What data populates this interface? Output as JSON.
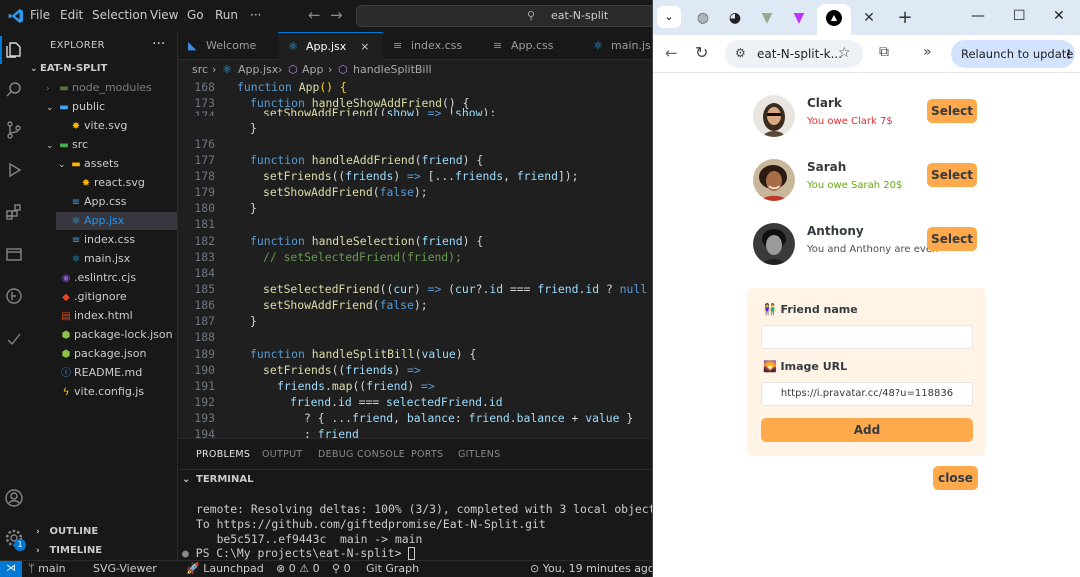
{
  "vscode": {
    "menu": [
      "File",
      "Edit",
      "Selection",
      "View",
      "Go",
      "Run",
      "···"
    ],
    "search_text": "eat-N-split",
    "explorer": {
      "title": "EXPLORER",
      "project": "EAT-N-SPLIT",
      "items": [
        {
          "label": "node_modules",
          "icon": "folder-icon"
        },
        {
          "label": "public",
          "icon": "folder-icon"
        },
        {
          "label": "vite.svg",
          "icon": "svg-file-icon"
        },
        {
          "label": "src",
          "icon": "folder-icon"
        },
        {
          "label": "assets",
          "icon": "folder-icon"
        },
        {
          "label": "react.svg",
          "icon": "svg-file-icon"
        },
        {
          "label": "App.css",
          "icon": "css-file-icon"
        },
        {
          "label": "App.jsx",
          "icon": "react-file-icon"
        },
        {
          "label": "index.css",
          "icon": "css-file-icon"
        },
        {
          "label": "main.jsx",
          "icon": "react-file-icon"
        },
        {
          "label": ".eslintrc.cjs",
          "icon": "eslint-file-icon"
        },
        {
          "label": ".gitignore",
          "icon": "git-file-icon"
        },
        {
          "label": "index.html",
          "icon": "html-file-icon"
        },
        {
          "label": "package-lock.json",
          "icon": "json-file-icon"
        },
        {
          "label": "package.json",
          "icon": "json-file-icon"
        },
        {
          "label": "README.md",
          "icon": "info-file-icon"
        },
        {
          "label": "vite.config.js",
          "icon": "js-file-icon"
        }
      ],
      "outline": "OUTLINE",
      "timeline": "TIMELINE"
    },
    "tabs": [
      "Welcome",
      "App.jsx",
      "index.css",
      "App.css",
      "main.js"
    ],
    "breadcrumb": [
      "src",
      "App.jsx",
      "App",
      "handleSplitBill"
    ],
    "line_numbers": [
      "168",
      "173",
      "174",
      "176",
      "177",
      "178",
      "179",
      "180",
      "181",
      "182",
      "183",
      "184",
      "185",
      "186",
      "187",
      "188",
      "189",
      "190",
      "191",
      "192",
      "193",
      "194"
    ],
    "panel_tabs": [
      "PROBLEMS",
      "OUTPUT",
      "DEBUG CONSOLE",
      "PORTS",
      "GITLENS"
    ],
    "terminal_title": "TERMINAL",
    "terminal_lines": [
      "remote: Resolving deltas: 100% (3/3), completed with 3 local objects.",
      "To https://github.com/giftedpromise/Eat-N-Split.git",
      "   be5c517..ef9443c  main -> main",
      "PS C:\\My projects\\eat-N-split> "
    ],
    "status": {
      "branch": "main",
      "svg_viewer": "SVG-Viewer",
      "launchpad": "Launchpad",
      "errors": "0",
      "warnings": "0",
      "ports": "0",
      "git_graph": "Git Graph",
      "blame": "You, 19 minutes ago",
      "badge": "1"
    }
  },
  "chrome": {
    "url": "eat-N-split-k...",
    "relaunch": "Relaunch to update",
    "friends": [
      {
        "name": "Clark",
        "balance": "You owe Clark 7$",
        "status": "owe"
      },
      {
        "name": "Sarah",
        "balance": "You owe Sarah 20$",
        "status": "owed"
      },
      {
        "name": "Anthony",
        "balance": "You and Anthony are even",
        "status": "even"
      }
    ],
    "select_label": "Select",
    "form": {
      "name_label": "Friend name",
      "name_value": "",
      "image_label": "Image URL",
      "image_value": "https://i.pravatar.cc/48?u=118836",
      "add_label": "Add"
    },
    "close_label": "close",
    "colors": {
      "accent": "#ffa94d",
      "form_bg": "#fff4e6",
      "owe": "#e03131",
      "owed": "#66a80f"
    }
  }
}
